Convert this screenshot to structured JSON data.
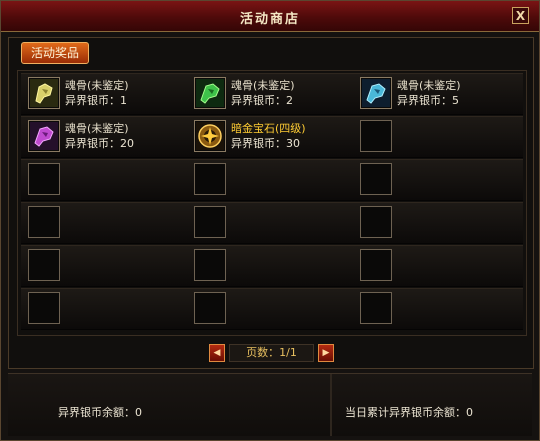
{
  "window": {
    "title": "活动商店",
    "close_label": "X"
  },
  "tabs": [
    {
      "label": "活动奖品",
      "active": true
    }
  ],
  "items": [
    {
      "name": "魂骨(未鉴定)",
      "price": "异界银币：1",
      "icon": "yellow-beast-bone-icon",
      "name_color": "#f2ead2"
    },
    {
      "name": "魂骨(未鉴定)",
      "price": "异界银币：2",
      "icon": "green-beast-bone-icon",
      "name_color": "#f2ead2"
    },
    {
      "name": "魂骨(未鉴定)",
      "price": "异界银币：5",
      "icon": "blue-beast-bone-icon",
      "name_color": "#f2ead2"
    },
    {
      "name": "魂骨(未鉴定)",
      "price": "异界银币：20",
      "icon": "purple-beast-bone-icon",
      "name_color": "#f2ead2"
    },
    {
      "name": "暗金宝石(四级)",
      "price": "异界银币：30",
      "icon": "dark-gold-gem-icon",
      "name_color": "#ffcc33"
    }
  ],
  "pager": {
    "text": "页数：1/1",
    "prev_label": "◀",
    "next_label": "▶"
  },
  "footer": {
    "balance": "异界银币余额：0",
    "daily_total": "当日累计异界银币余额：0"
  }
}
